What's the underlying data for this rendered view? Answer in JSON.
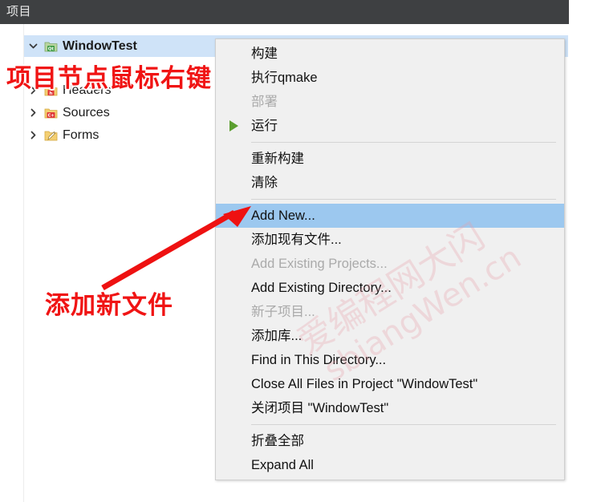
{
  "panel": {
    "header_title": "项目",
    "tree": [
      {
        "label": "WindowTest",
        "icon": "qt-project-icon",
        "twisty": "expanded",
        "selected": true,
        "indent": 0
      },
      {
        "label": "Headers",
        "icon": "headers-folder-icon",
        "twisty": "collapsed",
        "selected": false,
        "indent": 1
      },
      {
        "label": "Sources",
        "icon": "sources-folder-icon",
        "twisty": "collapsed",
        "selected": false,
        "indent": 1
      },
      {
        "label": "Forms",
        "icon": "forms-folder-icon",
        "twisty": "collapsed",
        "selected": false,
        "indent": 1
      }
    ]
  },
  "context_menu": {
    "items": [
      {
        "label": "构建",
        "icon": "",
        "disabled": false,
        "highlighted": false
      },
      {
        "label": "执行qmake",
        "icon": "",
        "disabled": false,
        "highlighted": false
      },
      {
        "label": "部署",
        "icon": "",
        "disabled": true,
        "highlighted": false
      },
      {
        "label": "运行",
        "icon": "run-play-icon",
        "disabled": false,
        "highlighted": false
      },
      {
        "separator": true
      },
      {
        "label": "重新构建",
        "icon": "",
        "disabled": false,
        "highlighted": false
      },
      {
        "label": "清除",
        "icon": "",
        "disabled": false,
        "highlighted": false
      },
      {
        "separator": true
      },
      {
        "label": "Add New...",
        "icon": "",
        "disabled": false,
        "highlighted": true
      },
      {
        "label": "添加现有文件...",
        "icon": "",
        "disabled": false,
        "highlighted": false
      },
      {
        "label": "Add Existing Projects...",
        "icon": "",
        "disabled": true,
        "highlighted": false
      },
      {
        "label": "Add Existing Directory...",
        "icon": "",
        "disabled": false,
        "highlighted": false
      },
      {
        "label": "新子项目...",
        "icon": "",
        "disabled": true,
        "highlighted": false
      },
      {
        "label": "添加库...",
        "icon": "",
        "disabled": false,
        "highlighted": false
      },
      {
        "label": "Find in This Directory...",
        "icon": "",
        "disabled": false,
        "highlighted": false
      },
      {
        "label": "Close All Files in Project \"WindowTest\"",
        "icon": "",
        "disabled": false,
        "highlighted": false
      },
      {
        "label": "关闭项目 \"WindowTest\"",
        "icon": "",
        "disabled": false,
        "highlighted": false
      },
      {
        "separator": true
      },
      {
        "label": "折叠全部",
        "icon": "",
        "disabled": false,
        "highlighted": false
      },
      {
        "label": "Expand All",
        "icon": "",
        "disabled": false,
        "highlighted": false
      }
    ]
  },
  "annotations": {
    "right_click_note": "项目节点鼠标右键",
    "add_new_note": "添加新文件",
    "arrow": "red-arrow-icon",
    "color": "#f01414"
  },
  "watermark": {
    "line1": "爱编程网大闪",
    "line2": "sbiangWen.cn"
  },
  "colors": {
    "header_bg": "#3e4042",
    "selection_bg": "#cfe3f8",
    "menu_bg": "#f0f0f0",
    "menu_highlight": "#9cc8ef",
    "disabled_text": "#aaaaaa",
    "annotation_red": "#f01414"
  }
}
